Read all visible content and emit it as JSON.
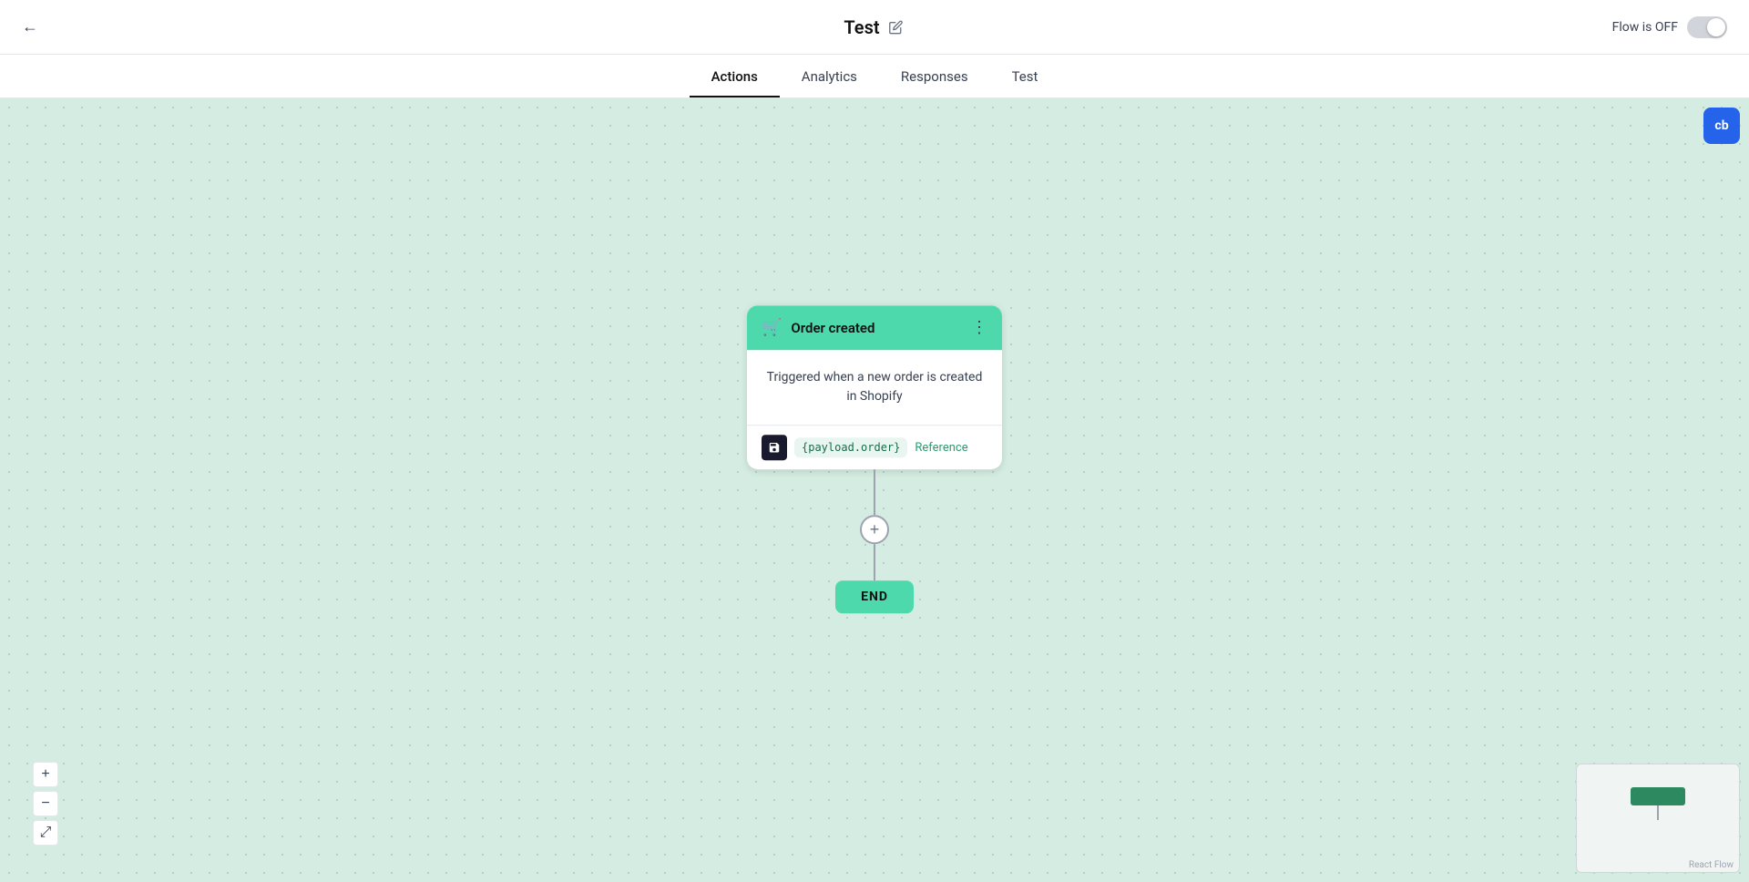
{
  "header": {
    "back_label": "←",
    "title": "Test",
    "edit_icon": "✏️",
    "flow_status_label": "Flow is OFF"
  },
  "tabs": [
    {
      "id": "actions",
      "label": "Actions",
      "active": true
    },
    {
      "id": "analytics",
      "label": "Analytics",
      "active": false
    },
    {
      "id": "responses",
      "label": "Responses",
      "active": false
    },
    {
      "id": "test",
      "label": "Test",
      "active": false
    }
  ],
  "canvas": {
    "node": {
      "title": "Order created",
      "description": "Triggered when a new order is created in Shopify",
      "payload_tag": "{payload.order}",
      "reference_label": "Reference",
      "menu_icon": "⋮",
      "cart_icon": "🛒",
      "save_icon": "💾"
    },
    "add_button_label": "+",
    "end_node_label": "END"
  },
  "zoom": {
    "plus_label": "+",
    "minus_label": "−",
    "fit_label": "⤢"
  },
  "minimap": {
    "label": "React Flow"
  },
  "logo": {
    "text": "cb"
  }
}
